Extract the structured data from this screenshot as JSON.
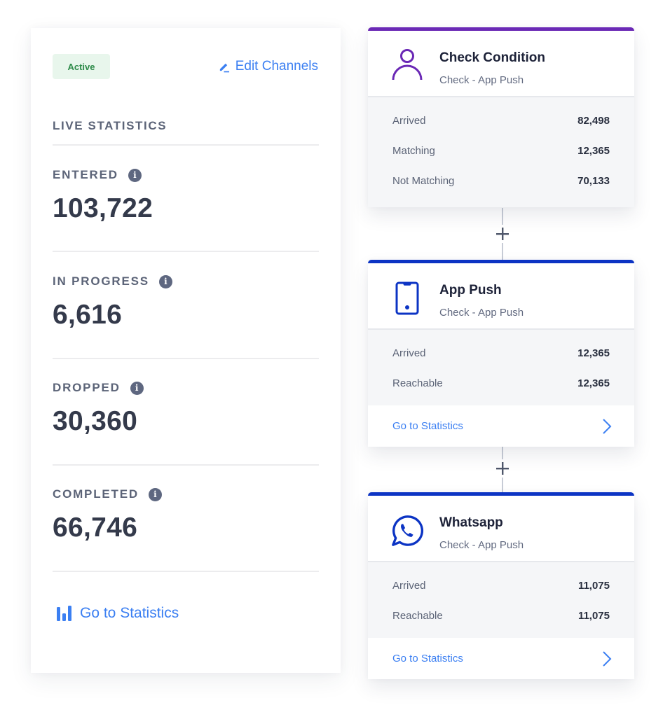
{
  "colors": {
    "accent_blue": "#3b7ff2",
    "badge_bg": "#e8f6ec",
    "badge_text": "#2e8b4a",
    "condition_purple": "#6a28b5",
    "channel_blue": "#0c34c4"
  },
  "left_panel": {
    "status_badge": "Active",
    "edit_channels_label": "Edit Channels",
    "edit_icon": "pencil-icon",
    "section_title": "LIVE STATISTICS",
    "stats": [
      {
        "label": "ENTERED",
        "value": "103,722",
        "icon": "info-icon"
      },
      {
        "label": "IN PROGRESS",
        "value": "6,616",
        "icon": "info-icon"
      },
      {
        "label": "DROPPED",
        "value": "30,360",
        "icon": "info-icon"
      },
      {
        "label": "COMPLETED",
        "value": "66,746",
        "icon": "info-icon"
      }
    ],
    "info_glyph": "i",
    "go_to_statistics_label": "Go to Statistics",
    "go_to_statistics_icon": "bar-chart-icon"
  },
  "flow": {
    "connector_icon": "+",
    "cards": [
      {
        "title": "Check Condition",
        "subtitle": "Check - App Push",
        "icon": "user-icon",
        "metrics": [
          {
            "label": "Arrived",
            "value": "82,498"
          },
          {
            "label": "Matching",
            "value": "12,365"
          },
          {
            "label": "Not Matching",
            "value": "70,133"
          }
        ]
      },
      {
        "title": "App Push",
        "subtitle": "Check - App Push",
        "icon": "smartphone-icon",
        "metrics": [
          {
            "label": "Arrived",
            "value": "12,365"
          },
          {
            "label": "Reachable",
            "value": "12,365"
          }
        ],
        "footer_label": "Go to Statistics"
      },
      {
        "title": "Whatsapp",
        "subtitle": "Check - App Push",
        "icon": "whatsapp-icon",
        "metrics": [
          {
            "label": "Arrived",
            "value": "11,075"
          },
          {
            "label": "Reachable",
            "value": "11,075"
          }
        ],
        "footer_label": "Go to Statistics"
      }
    ]
  }
}
